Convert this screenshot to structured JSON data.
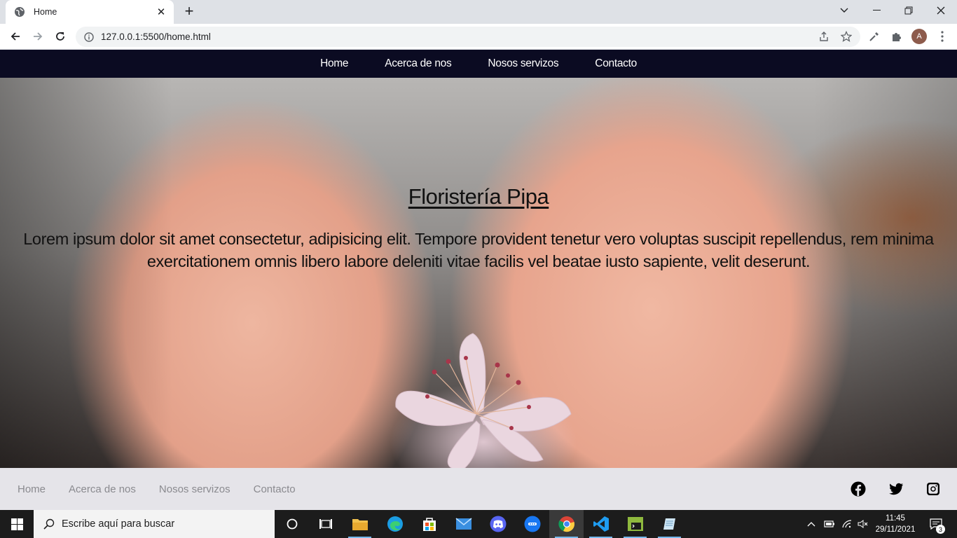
{
  "browser": {
    "tab_title": "Home",
    "url": "127.0.0.1:5500/home.html",
    "profile_initial": "A"
  },
  "nav": {
    "items": [
      {
        "label": "Home"
      },
      {
        "label": "Acerca de nos"
      },
      {
        "label": "Nosos servizos"
      },
      {
        "label": "Contacto"
      }
    ]
  },
  "hero": {
    "title": "Floristería Pipa",
    "body": "Lorem ipsum dolor sit amet consectetur, adipisicing elit. Tempore provident tenetur vero voluptas suscipit repellendus, rem minima exercitationem omnis libero labore deleniti vitae facilis vel beatae iusto sapiente, velit deserunt."
  },
  "footer": {
    "links": [
      {
        "label": "Home"
      },
      {
        "label": "Acerca de nos"
      },
      {
        "label": "Nosos servizos"
      },
      {
        "label": "Contacto"
      }
    ],
    "social": [
      "facebook-icon",
      "twitter-icon",
      "instagram-icon"
    ]
  },
  "taskbar": {
    "search_placeholder": "Escribe aquí para buscar",
    "time": "11:45",
    "date": "29/11/2021",
    "notification_count": "3"
  },
  "colors": {
    "nav_bg": "#0b0b22",
    "footer_bg": "#e5e4e9",
    "footer_link": "#8a8a8f"
  }
}
